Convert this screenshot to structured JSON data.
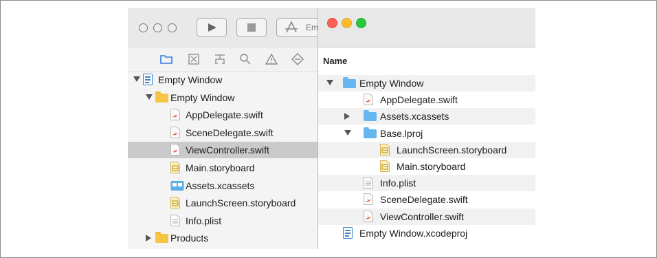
{
  "xcode": {
    "scheme_label": "Emp",
    "tree": [
      {
        "label": "Empty Window",
        "icon": "xcodeproj-icon",
        "indent": 0,
        "disclosure": "open",
        "selected": false
      },
      {
        "label": "Empty Window",
        "icon": "folder-yellow-icon",
        "indent": 1,
        "disclosure": "open",
        "selected": false
      },
      {
        "label": "AppDelegate.swift",
        "icon": "swift-file-icon",
        "indent": 2,
        "disclosure": "none",
        "selected": false
      },
      {
        "label": "SceneDelegate.swift",
        "icon": "swift-file-icon",
        "indent": 2,
        "disclosure": "none",
        "selected": false
      },
      {
        "label": "ViewController.swift",
        "icon": "swift-file-icon",
        "indent": 2,
        "disclosure": "none",
        "selected": true
      },
      {
        "label": "Main.storyboard",
        "icon": "storyboard-file-icon",
        "indent": 2,
        "disclosure": "none",
        "selected": false
      },
      {
        "label": "Assets.xcassets",
        "icon": "asset-catalog-icon",
        "indent": 2,
        "disclosure": "none",
        "selected": false
      },
      {
        "label": "LaunchScreen.storyboard",
        "icon": "storyboard-file-icon",
        "indent": 2,
        "disclosure": "none",
        "selected": false
      },
      {
        "label": "Info.plist",
        "icon": "plist-file-icon",
        "indent": 2,
        "disclosure": "none",
        "selected": false
      },
      {
        "label": "Products",
        "icon": "folder-yellow-icon",
        "indent": 1,
        "disclosure": "closed",
        "selected": false
      }
    ]
  },
  "finder": {
    "column_header": "Name",
    "traffic_lights": {
      "close": "#fe5f57",
      "minimize": "#febc2e",
      "zoom": "#28c840"
    },
    "tree": [
      {
        "label": "Empty Window",
        "icon": "folder-blue-icon",
        "indent": 0,
        "disclosure": "open"
      },
      {
        "label": "AppDelegate.swift",
        "icon": "swift-file-icon",
        "indent": 1,
        "disclosure": "none"
      },
      {
        "label": "Assets.xcassets",
        "icon": "folder-blue-icon",
        "indent": 1,
        "disclosure": "closed"
      },
      {
        "label": "Base.lproj",
        "icon": "folder-blue-icon",
        "indent": 1,
        "disclosure": "open"
      },
      {
        "label": "LaunchScreen.storyboard",
        "icon": "storyboard-file-icon",
        "indent": 2,
        "disclosure": "none"
      },
      {
        "label": "Main.storyboard",
        "icon": "storyboard-file-icon",
        "indent": 2,
        "disclosure": "none"
      },
      {
        "label": "Info.plist",
        "icon": "plist-file-icon",
        "indent": 1,
        "disclosure": "none"
      },
      {
        "label": "SceneDelegate.swift",
        "icon": "swift-file-icon",
        "indent": 1,
        "disclosure": "none"
      },
      {
        "label": "ViewController.swift",
        "icon": "swift-file-icon",
        "indent": 1,
        "disclosure": "none"
      },
      {
        "label": "Empty Window.xcodeproj",
        "icon": "xcodeproj-icon",
        "indent": 0,
        "disclosure": "none"
      }
    ]
  },
  "colors": {
    "selection": "#cacaca",
    "folder_blue": "#67b6ef",
    "folder_yellow": "#f6c544",
    "swift": "#f05138"
  }
}
